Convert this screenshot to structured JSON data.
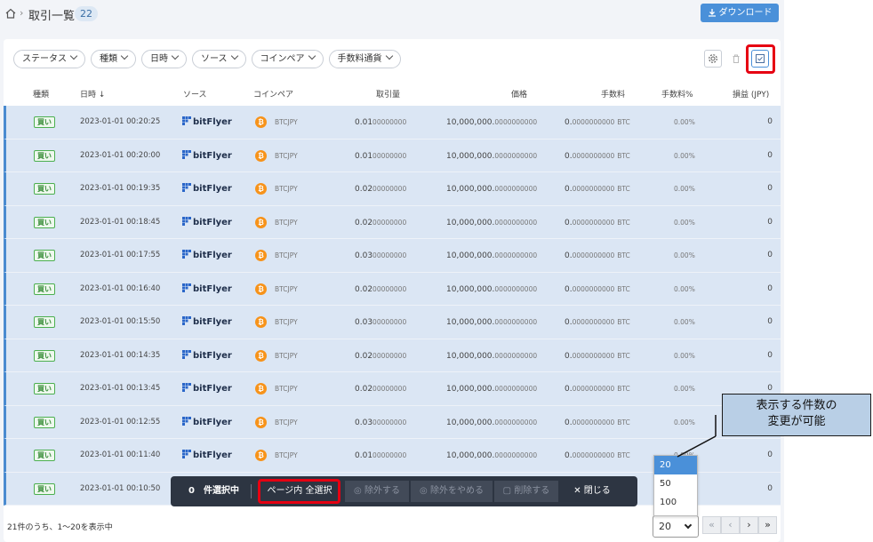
{
  "header": {
    "home_icon": "home-icon",
    "title": "取引一覧",
    "count": "22",
    "download_label": "ダウンロード"
  },
  "filters": [
    "ステータス",
    "種類",
    "日時",
    "ソース",
    "コインペア",
    "手数料通貨"
  ],
  "columns": {
    "type": "種類",
    "datetime": "日時 ↓",
    "source": "ソース",
    "pair": "コインペア",
    "amount": "取引量",
    "price": "価格",
    "fee": "手数料",
    "fee_pct": "手数料%",
    "pnl": "損益 (JPY)"
  },
  "rows": [
    {
      "type": "買い",
      "datetime": "2023-01-01 00:20:25",
      "source": "bitFlyer",
      "pair": "BTCJPY",
      "amount_int": "0.01",
      "amount_frac": "00000000",
      "price_int": "10,000,000.",
      "price_frac": "0000000000",
      "fee_int": "0.",
      "fee_frac": "0000000000",
      "fee_unit": "BTC",
      "fee_pct": "0.00%",
      "pnl": "0"
    },
    {
      "type": "買い",
      "datetime": "2023-01-01 00:20:00",
      "source": "bitFlyer",
      "pair": "BTCJPY",
      "amount_int": "0.01",
      "amount_frac": "00000000",
      "price_int": "10,000,000.",
      "price_frac": "0000000000",
      "fee_int": "0.",
      "fee_frac": "0000000000",
      "fee_unit": "BTC",
      "fee_pct": "0.00%",
      "pnl": "0"
    },
    {
      "type": "買い",
      "datetime": "2023-01-01 00:19:35",
      "source": "bitFlyer",
      "pair": "BTCJPY",
      "amount_int": "0.02",
      "amount_frac": "00000000",
      "price_int": "10,000,000.",
      "price_frac": "0000000000",
      "fee_int": "0.",
      "fee_frac": "0000000000",
      "fee_unit": "BTC",
      "fee_pct": "0.00%",
      "pnl": "0"
    },
    {
      "type": "買い",
      "datetime": "2023-01-01 00:18:45",
      "source": "bitFlyer",
      "pair": "BTCJPY",
      "amount_int": "0.02",
      "amount_frac": "00000000",
      "price_int": "10,000,000.",
      "price_frac": "0000000000",
      "fee_int": "0.",
      "fee_frac": "0000000000",
      "fee_unit": "BTC",
      "fee_pct": "0.00%",
      "pnl": "0"
    },
    {
      "type": "買い",
      "datetime": "2023-01-01 00:17:55",
      "source": "bitFlyer",
      "pair": "BTCJPY",
      "amount_int": "0.03",
      "amount_frac": "00000000",
      "price_int": "10,000,000.",
      "price_frac": "0000000000",
      "fee_int": "0.",
      "fee_frac": "0000000000",
      "fee_unit": "BTC",
      "fee_pct": "0.00%",
      "pnl": "0"
    },
    {
      "type": "買い",
      "datetime": "2023-01-01 00:16:40",
      "source": "bitFlyer",
      "pair": "BTCJPY",
      "amount_int": "0.02",
      "amount_frac": "00000000",
      "price_int": "10,000,000.",
      "price_frac": "0000000000",
      "fee_int": "0.",
      "fee_frac": "0000000000",
      "fee_unit": "BTC",
      "fee_pct": "0.00%",
      "pnl": "0"
    },
    {
      "type": "買い",
      "datetime": "2023-01-01 00:15:50",
      "source": "bitFlyer",
      "pair": "BTCJPY",
      "amount_int": "0.03",
      "amount_frac": "00000000",
      "price_int": "10,000,000.",
      "price_frac": "0000000000",
      "fee_int": "0.",
      "fee_frac": "0000000000",
      "fee_unit": "BTC",
      "fee_pct": "0.00%",
      "pnl": "0"
    },
    {
      "type": "買い",
      "datetime": "2023-01-01 00:14:35",
      "source": "bitFlyer",
      "pair": "BTCJPY",
      "amount_int": "0.02",
      "amount_frac": "00000000",
      "price_int": "10,000,000.",
      "price_frac": "0000000000",
      "fee_int": "0.",
      "fee_frac": "0000000000",
      "fee_unit": "BTC",
      "fee_pct": "0.00%",
      "pnl": "0"
    },
    {
      "type": "買い",
      "datetime": "2023-01-01 00:13:45",
      "source": "bitFlyer",
      "pair": "BTCJPY",
      "amount_int": "0.02",
      "amount_frac": "00000000",
      "price_int": "10,000,000.",
      "price_frac": "0000000000",
      "fee_int": "0.",
      "fee_frac": "0000000000",
      "fee_unit": "BTC",
      "fee_pct": "0.00%",
      "pnl": "0"
    },
    {
      "type": "買い",
      "datetime": "2023-01-01 00:12:55",
      "source": "bitFlyer",
      "pair": "BTCJPY",
      "amount_int": "0.03",
      "amount_frac": "00000000",
      "price_int": "10,000,000.",
      "price_frac": "0000000000",
      "fee_int": "0.",
      "fee_frac": "0000000000",
      "fee_unit": "BTC",
      "fee_pct": "0.00%",
      "pnl": "0"
    },
    {
      "type": "買い",
      "datetime": "2023-01-01 00:11:40",
      "source": "bitFlyer",
      "pair": "BTCJPY",
      "amount_int": "0.01",
      "amount_frac": "00000000",
      "price_int": "10,000,000.",
      "price_frac": "0000000000",
      "fee_int": "0.",
      "fee_frac": "0000000000",
      "fee_unit": "BTC",
      "fee_pct": "0.00%",
      "pnl": "0"
    },
    {
      "type": "買い",
      "datetime": "2023-01-01 00:10:50",
      "source": "",
      "pair": "",
      "amount_int": "",
      "amount_frac": "",
      "price_int": "",
      "price_frac": "",
      "fee_int": "",
      "fee_frac": "",
      "fee_unit": "",
      "fee_pct": "",
      "pnl": "0"
    }
  ],
  "action_bar": {
    "selected_count": "0",
    "selected_label": "件選択中",
    "select_page": "ページ内 全選択",
    "exclude": "除外する",
    "unexclude": "除外をやめる",
    "delete": "削除する",
    "close": "閉じる"
  },
  "footer": {
    "summary": "21件のうち、1〜20を表示中",
    "page_size": "20",
    "page_size_options": [
      "20",
      "50",
      "100"
    ],
    "first": "«",
    "prev": "‹",
    "next": "›",
    "last": "»"
  },
  "callout": {
    "line1": "表示する件数の",
    "line2": "変更が可能"
  },
  "colors": {
    "accent": "#4a90d9",
    "highlight_red": "#e60012",
    "row_selected": "#dbe6f4",
    "buy_badge": "#4caf50",
    "btc": "#f7931a"
  }
}
